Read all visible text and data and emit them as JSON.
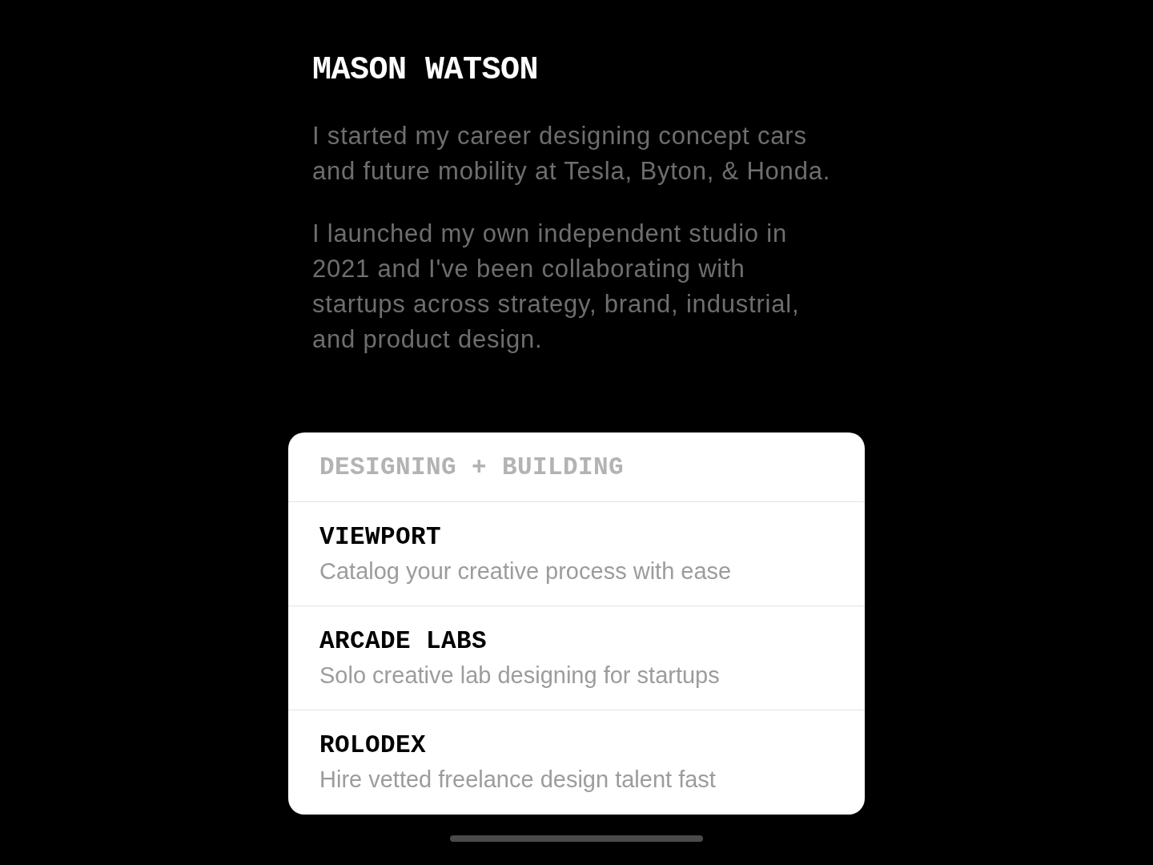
{
  "profile": {
    "name": "MASON WATSON",
    "bio": [
      "I started my career designing concept cars and future mobility at Tesla, Byton, & Honda.",
      "I launched my own independent studio in 2021 and I've been collaborating with startups across strategy, brand, industrial, and product design."
    ]
  },
  "projects_card": {
    "heading": "DESIGNING + BUILDING",
    "items": [
      {
        "title": "VIEWPORT",
        "description": "Catalog your creative process with ease"
      },
      {
        "title": "ARCADE LABS",
        "description": "Solo creative lab designing for startups"
      },
      {
        "title": "ROLODEX",
        "description": "Hire vetted freelance design talent fast"
      }
    ]
  }
}
